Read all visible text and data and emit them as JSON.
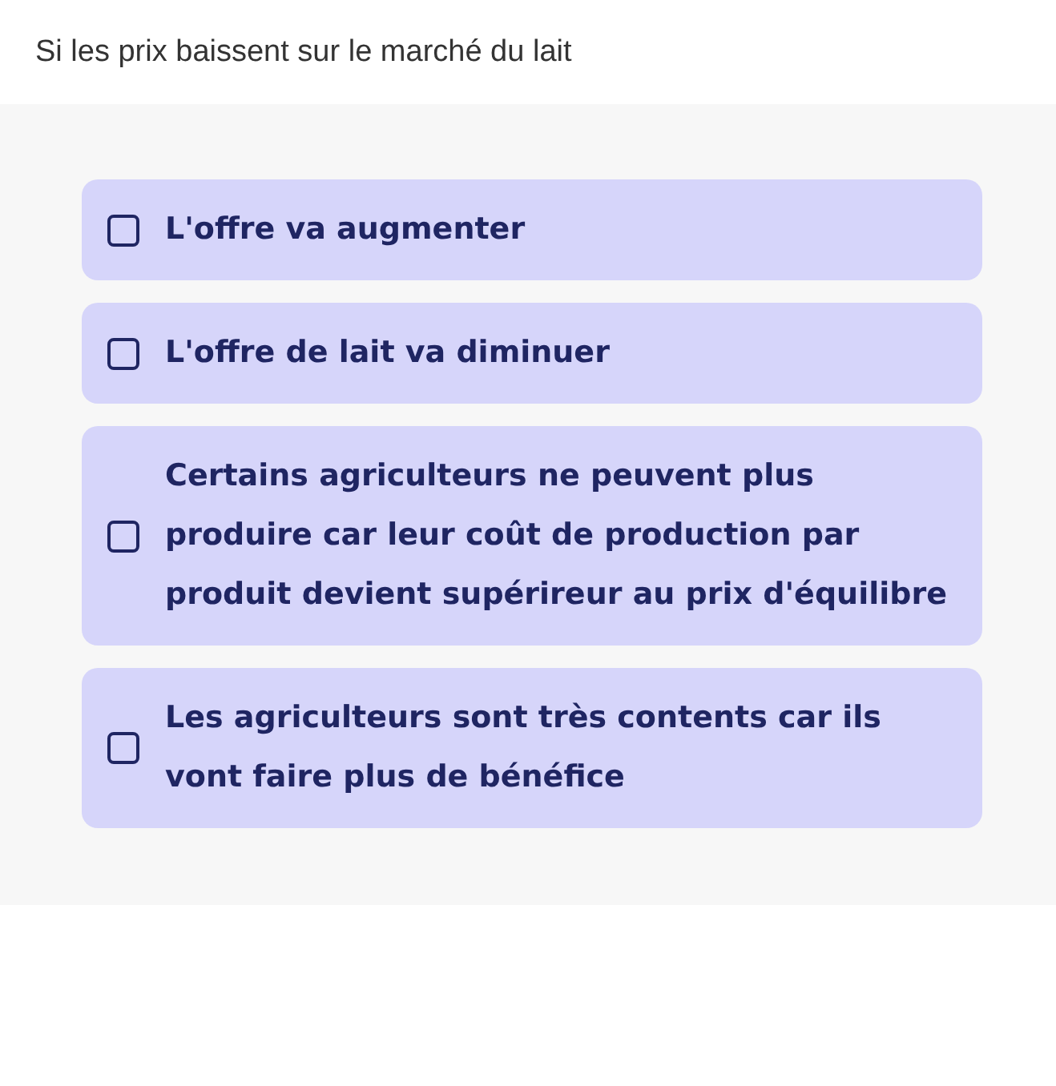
{
  "question": "Si les prix baissent sur le marché du lait",
  "options": [
    {
      "label": "L'offre va augmenter",
      "checked": false
    },
    {
      "label": "L'offre de lait va diminuer",
      "checked": false
    },
    {
      "label": "Certains agriculteurs ne peuvent plus produire car leur coût de production par produit devient supérireur au prix d'équilibre",
      "checked": false
    },
    {
      "label": "Les agriculteurs sont très contents car ils vont faire plus de bénéfice",
      "checked": false
    }
  ]
}
